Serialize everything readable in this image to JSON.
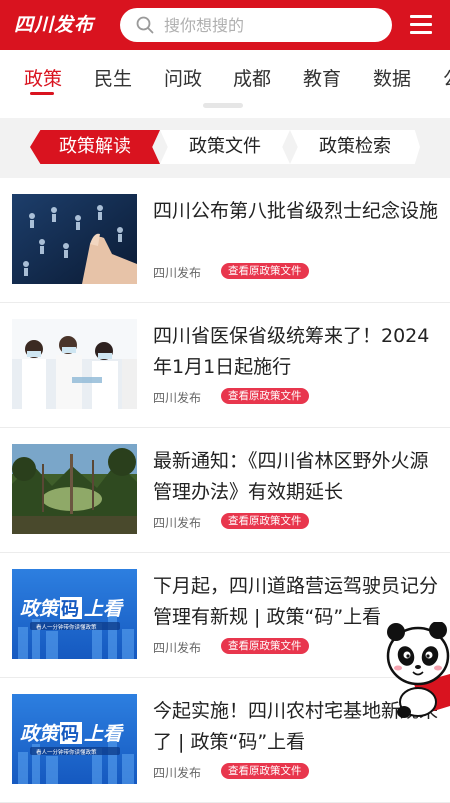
{
  "header": {
    "logo_text": "四川发布",
    "search_placeholder": "搜你想搜的",
    "icons": [
      "search-icon",
      "menu-icon"
    ]
  },
  "categories": [
    {
      "label": "政策",
      "active": true
    },
    {
      "label": "民生",
      "active": false
    },
    {
      "label": "问政",
      "active": false
    },
    {
      "label": "成都",
      "active": false
    },
    {
      "label": "教育",
      "active": false
    },
    {
      "label": "数据",
      "active": false
    },
    {
      "label": "公",
      "active": false
    }
  ],
  "subtabs": [
    {
      "label": "政策解读",
      "active": true
    },
    {
      "label": "政策文件",
      "active": false
    },
    {
      "label": "政策检索",
      "active": false
    }
  ],
  "articles": [
    {
      "title": "四川公布第八批省级烈士纪念设施",
      "source": "四川发布",
      "tag": "查看原政策文件",
      "thumb": "hand-touch-icons"
    },
    {
      "title": "四川省医保省级统筹来了！2024年1月1日起施行",
      "source": "四川发布",
      "tag": "查看原政策文件",
      "thumb": "medical-team"
    },
    {
      "title": "最新通知：《四川省林区野外火源管理办法》有效期延长",
      "source": "四川发布",
      "tag": "查看原政策文件",
      "thumb": "forest"
    },
    {
      "title": "下月起，四川道路营运驾驶员记分管理有新规 | 政策“码”上看",
      "source": "四川发布",
      "tag": "查看原政策文件",
      "thumb": "policy-code-banner",
      "thumb_text": "政策码上看",
      "thumb_sub": "看人一分钟带你读懂政策"
    },
    {
      "title": "今起实施！四川农村宅基地新规来了 | 政策“码”上看",
      "source": "四川发布",
      "tag": "查看原政策文件",
      "thumb": "policy-code-banner",
      "thumb_text": "政策码上看",
      "thumb_sub": "看人一分钟带你读懂政策"
    }
  ],
  "colors": {
    "brand_red": "#d9131f",
    "tag_red": "#e8364d",
    "band_gray": "#f2f2f2"
  }
}
